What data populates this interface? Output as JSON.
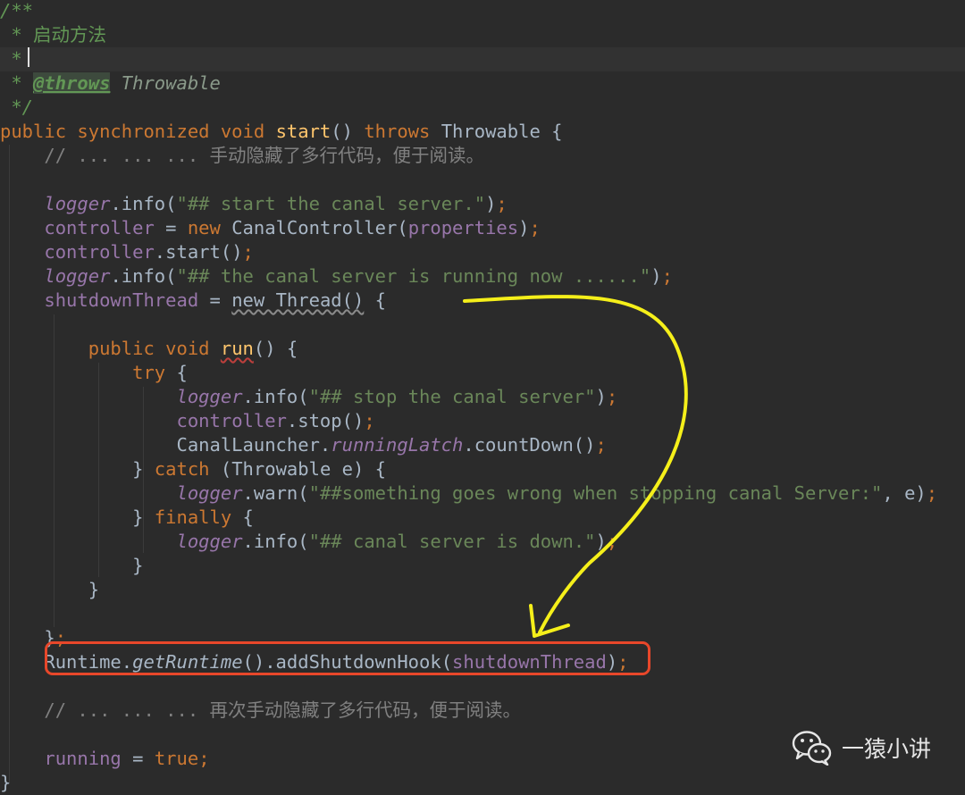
{
  "editor": {
    "lines": [
      [
        {
          "t": "/**",
          "c": "comment"
        }
      ],
      [
        {
          "t": " * ",
          "c": "comment"
        },
        {
          "t": "启动方法",
          "c": "comment-cjk"
        }
      ],
      [
        {
          "t": " *",
          "c": "comment"
        }
      ],
      [
        {
          "t": " * ",
          "c": "comment"
        },
        {
          "t": "@throws",
          "c": "tag"
        },
        {
          "t": " Throwable",
          "c": "tag-value"
        }
      ],
      [
        {
          "t": " */",
          "c": "comment"
        }
      ],
      [
        {
          "t": "public synchronized void ",
          "c": "kw"
        },
        {
          "t": "start",
          "c": "fn"
        },
        {
          "t": "() "
        },
        {
          "t": "throws ",
          "c": "kw"
        },
        {
          "t": "Throwable {"
        }
      ],
      [
        {
          "t": "    // ... ... ... ",
          "c": "line-comment"
        },
        {
          "t": "手动隐藏了多行代码，便于阅读。",
          "c": "line-comment-cjk"
        }
      ],
      [],
      [
        {
          "t": "    "
        },
        {
          "t": "logger",
          "c": "sfield"
        },
        {
          "t": ".info("
        },
        {
          "t": "\"## start the canal server.\"",
          "c": "str"
        },
        {
          "t": ")"
        },
        {
          "t": ";",
          "c": "kw"
        }
      ],
      [
        {
          "t": "    "
        },
        {
          "t": "controller",
          "c": "field"
        },
        {
          "t": " = "
        },
        {
          "t": "new ",
          "c": "kw"
        },
        {
          "t": "CanalController("
        },
        {
          "t": "properties",
          "c": "field"
        },
        {
          "t": ")"
        },
        {
          "t": ";",
          "c": "kw"
        }
      ],
      [
        {
          "t": "    "
        },
        {
          "t": "controller",
          "c": "field"
        },
        {
          "t": ".start()"
        },
        {
          "t": ";",
          "c": "kw"
        }
      ],
      [
        {
          "t": "    "
        },
        {
          "t": "logger",
          "c": "sfield"
        },
        {
          "t": ".info("
        },
        {
          "t": "\"## the canal server is running now ......\"",
          "c": "str"
        },
        {
          "t": ")"
        },
        {
          "t": ";",
          "c": "kw"
        }
      ],
      [
        {
          "t": "    "
        },
        {
          "t": "shutdownThread",
          "c": "field"
        },
        {
          "t": " = "
        },
        {
          "t": "new Thread()",
          "c": "warn-underline"
        },
        {
          "t": " {"
        }
      ],
      [],
      [
        {
          "t": "        "
        },
        {
          "t": "public void ",
          "c": "kw"
        },
        {
          "t": "run",
          "c": "fn err-underline"
        },
        {
          "t": "() {"
        }
      ],
      [
        {
          "t": "            "
        },
        {
          "t": "try ",
          "c": "kw"
        },
        {
          "t": "{"
        }
      ],
      [
        {
          "t": "                "
        },
        {
          "t": "logger",
          "c": "sfield"
        },
        {
          "t": ".info("
        },
        {
          "t": "\"## stop the canal server\"",
          "c": "str"
        },
        {
          "t": ")"
        },
        {
          "t": ";",
          "c": "kw"
        }
      ],
      [
        {
          "t": "                "
        },
        {
          "t": "controller",
          "c": "field"
        },
        {
          "t": ".stop()"
        },
        {
          "t": ";",
          "c": "kw"
        }
      ],
      [
        {
          "t": "                CanalLauncher."
        },
        {
          "t": "runningLatch",
          "c": "sfield"
        },
        {
          "t": ".countDown()"
        },
        {
          "t": ";",
          "c": "kw"
        }
      ],
      [
        {
          "t": "            } "
        },
        {
          "t": "catch ",
          "c": "kw"
        },
        {
          "t": "(Throwable e) {"
        }
      ],
      [
        {
          "t": "                "
        },
        {
          "t": "logger",
          "c": "sfield"
        },
        {
          "t": ".warn("
        },
        {
          "t": "\"##something goes wrong when stopping canal Server:\"",
          "c": "str"
        },
        {
          "t": ", "
        },
        {
          "t": "e)"
        },
        {
          "t": ";",
          "c": "kw"
        }
      ],
      [
        {
          "t": "            } "
        },
        {
          "t": "finally ",
          "c": "kw"
        },
        {
          "t": "{"
        }
      ],
      [
        {
          "t": "                "
        },
        {
          "t": "logger",
          "c": "sfield"
        },
        {
          "t": ".info("
        },
        {
          "t": "\"## canal server is down.\"",
          "c": "str"
        },
        {
          "t": ")"
        },
        {
          "t": ";",
          "c": "kw"
        }
      ],
      [
        {
          "t": "            }"
        }
      ],
      [
        {
          "t": "        }"
        }
      ],
      [],
      [
        {
          "t": "    }"
        },
        {
          "t": ";",
          "c": "kw"
        }
      ],
      [
        {
          "t": "    Runtime."
        },
        {
          "t": "getRuntime",
          "c": "smethod"
        },
        {
          "t": "().addShutdownHook("
        },
        {
          "t": "shutdownThread",
          "c": "field"
        },
        {
          "t": ")"
        },
        {
          "t": ";",
          "c": "kw"
        }
      ],
      [],
      [
        {
          "t": "    // ... ... ... ",
          "c": "line-comment"
        },
        {
          "t": "再次手动隐藏了多行代码，便于阅读。",
          "c": "line-comment-cjk"
        }
      ],
      [],
      [
        {
          "t": "    "
        },
        {
          "t": "running",
          "c": "field"
        },
        {
          "t": " = "
        },
        {
          "t": "true",
          "c": "kw"
        },
        {
          "t": ";",
          "c": "kw"
        }
      ],
      [
        {
          "t": "}"
        }
      ]
    ]
  },
  "watermark": {
    "icon": "wechat-icon",
    "text": "一猿小讲"
  },
  "annotations": {
    "highlight_color": "#e8472a",
    "arrow_color": "#f5ef1a"
  }
}
